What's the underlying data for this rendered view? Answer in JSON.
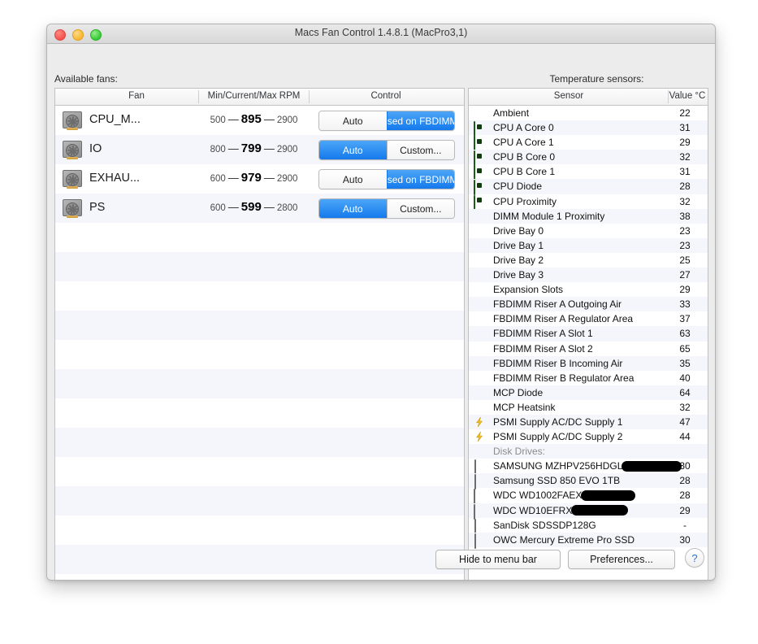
{
  "window": {
    "title": "Macs Fan Control 1.4.8.1 (MacPro3,1)",
    "traffic_lights": [
      "close-button",
      "minimize-button",
      "zoom-button"
    ]
  },
  "fans_panel": {
    "label": "Available fans:",
    "columns": [
      "Fan",
      "Min/Current/Max RPM",
      "Control"
    ],
    "rows": [
      {
        "icon": "fan-icon",
        "name": "CPU_M...",
        "min": "500",
        "current": "895",
        "max": "2900",
        "control": {
          "left_label": "Auto",
          "right_label": "Based on FBDIMM...",
          "active": "right"
        }
      },
      {
        "icon": "fan-icon",
        "name": "IO",
        "min": "800",
        "current": "799",
        "max": "2900",
        "control": {
          "left_label": "Auto",
          "right_label": "Custom...",
          "active": "left"
        }
      },
      {
        "icon": "fan-icon",
        "name": "EXHAU...",
        "min": "600",
        "current": "979",
        "max": "2900",
        "control": {
          "left_label": "Auto",
          "right_label": "Based on FBDIMM...",
          "active": "right"
        }
      },
      {
        "icon": "fan-icon",
        "name": "PS",
        "min": "600",
        "current": "599",
        "max": "2800",
        "control": {
          "left_label": "Auto",
          "right_label": "Custom...",
          "active": "left"
        }
      }
    ],
    "empty_row_count": 13
  },
  "sensors_panel": {
    "label": "Temperature sensors:",
    "columns": [
      "Sensor",
      "Value °C"
    ],
    "rows": [
      {
        "icon": "none",
        "name": "Ambient",
        "value": "22"
      },
      {
        "icon": "chip",
        "name": "CPU A Core 0",
        "value": "31"
      },
      {
        "icon": "chip",
        "name": "CPU A Core 1",
        "value": "29"
      },
      {
        "icon": "chip",
        "name": "CPU B Core 0",
        "value": "32"
      },
      {
        "icon": "chip",
        "name": "CPU B Core 1",
        "value": "31"
      },
      {
        "icon": "chip",
        "name": "CPU Diode",
        "value": "28"
      },
      {
        "icon": "chip",
        "name": "CPU Proximity",
        "value": "32"
      },
      {
        "icon": "none",
        "name": "DIMM Module 1 Proximity",
        "value": "38"
      },
      {
        "icon": "none",
        "name": "Drive Bay 0",
        "value": "23"
      },
      {
        "icon": "none",
        "name": "Drive Bay 1",
        "value": "23"
      },
      {
        "icon": "none",
        "name": "Drive Bay 2",
        "value": "25"
      },
      {
        "icon": "none",
        "name": "Drive Bay 3",
        "value": "27"
      },
      {
        "icon": "none",
        "name": "Expansion Slots",
        "value": "29"
      },
      {
        "icon": "none",
        "name": "FBDIMM Riser A Outgoing Air",
        "value": "33"
      },
      {
        "icon": "none",
        "name": "FBDIMM Riser A Regulator Area",
        "value": "37"
      },
      {
        "icon": "none",
        "name": "FBDIMM Riser A Slot 1",
        "value": "63"
      },
      {
        "icon": "none",
        "name": "FBDIMM Riser A Slot 2",
        "value": "65"
      },
      {
        "icon": "none",
        "name": "FBDIMM Riser B Incoming Air",
        "value": "35"
      },
      {
        "icon": "none",
        "name": "FBDIMM Riser B Regulator Area",
        "value": "40"
      },
      {
        "icon": "none",
        "name": "MCP Diode",
        "value": "64"
      },
      {
        "icon": "none",
        "name": "MCP Heatsink",
        "value": "32"
      },
      {
        "icon": "bolt",
        "name": "PSMI Supply AC/DC Supply 1",
        "value": "47"
      },
      {
        "icon": "bolt",
        "name": "PSMI Supply AC/DC Supply 2",
        "value": "44"
      },
      {
        "icon": "none",
        "name": "Disk Drives:",
        "value": "",
        "group": true
      },
      {
        "icon": "ssd",
        "name": "SAMSUNG MZHPV256HDGL",
        "value": "30",
        "redact_width": 74
      },
      {
        "icon": "ssd",
        "name": "Samsung SSD 850 EVO 1TB",
        "value": "28"
      },
      {
        "icon": "hdd",
        "name": "WDC WD1002FAEX",
        "value": "28",
        "redact_width": 67
      },
      {
        "icon": "hdd",
        "name": "WDC WD10EFRX",
        "value": "29",
        "redact_width": 70
      },
      {
        "icon": "ssd",
        "name": "SanDisk SDSSDP128G",
        "value": "-"
      },
      {
        "icon": "ssd",
        "name": "OWC Mercury Extreme Pro SSD",
        "value": "30"
      }
    ]
  },
  "footer": {
    "hide_label": "Hide to menu bar",
    "preferences_label": "Preferences...",
    "help_label": "?"
  },
  "colors": {
    "accent_blue": "#1479ec",
    "window_bg": "#ececec",
    "row_alt": "#f5f6fb",
    "chip_green": "#2d7a28",
    "bolt_yellow": "#f2c01e"
  }
}
